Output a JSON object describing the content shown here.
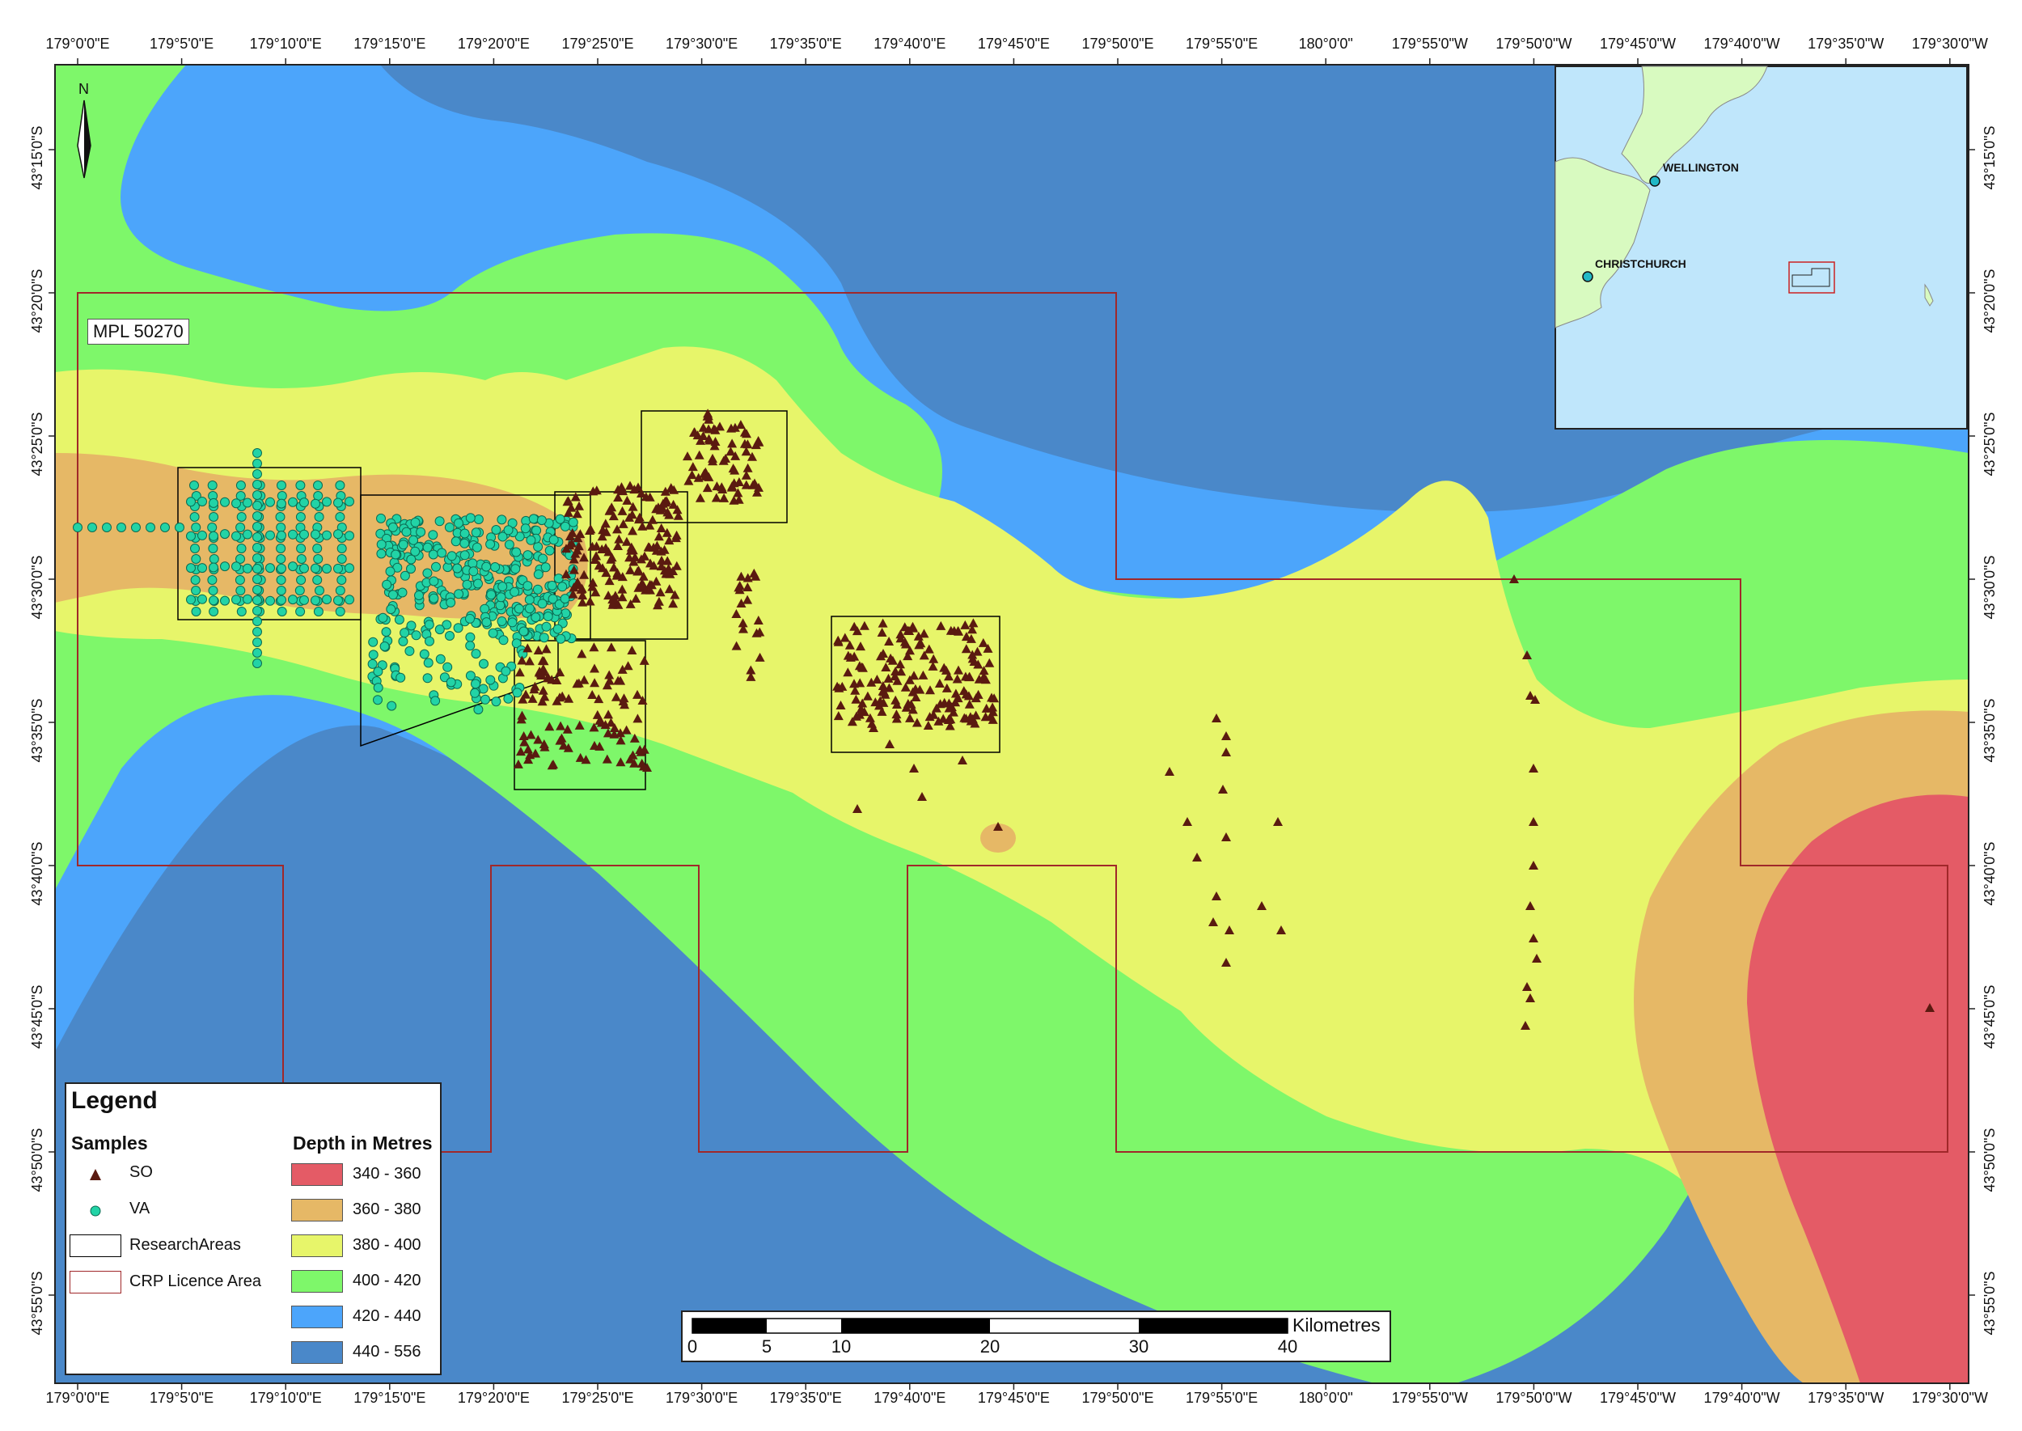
{
  "map": {
    "licence_label": "MPL 50270",
    "north": "N",
    "top_ticks": [
      "179°0'0\"E",
      "179°5'0\"E",
      "179°10'0\"E",
      "179°15'0\"E",
      "179°20'0\"E",
      "179°25'0\"E",
      "179°30'0\"E",
      "179°35'0\"E",
      "179°40'0\"E",
      "179°45'0\"E",
      "179°50'0\"E",
      "179°55'0\"E",
      "180°0'0\"",
      "179°55'0\"W",
      "179°50'0\"W",
      "179°45'0\"W",
      "179°40'0\"W",
      "179°35'0\"W",
      "179°30'0\"W"
    ],
    "side_ticks": [
      "43°15'0\"S",
      "43°20'0\"S",
      "43°25'0\"S",
      "43°30'0\"S",
      "43°35'0\"S",
      "43°40'0\"S",
      "43°45'0\"S",
      "43°50'0\"S",
      "43°55'0\"S"
    ]
  },
  "inset": {
    "wellington": "WELLINGTON",
    "christchurch": "CHRISTCHURCH"
  },
  "legend": {
    "title": "Legend",
    "samples_heading": "Samples",
    "depth_heading": "Depth in Metres",
    "samples": [
      {
        "label": "SO",
        "symbol": "triangle",
        "color": "#5a1a10"
      },
      {
        "label": "VA",
        "symbol": "circle",
        "color": "#22d3a6"
      },
      {
        "label": "ResearchAreas",
        "symbol": "box",
        "color": "#000000"
      },
      {
        "label": "CRP Licence Area",
        "symbol": "box",
        "color": "#a0282a"
      }
    ],
    "depths": [
      {
        "label": "340 - 360",
        "color": "#e45b66"
      },
      {
        "label": "360 - 380",
        "color": "#e6b866"
      },
      {
        "label": "380 - 400",
        "color": "#e7f56a"
      },
      {
        "label": "400 - 420",
        "color": "#7ef76a"
      },
      {
        "label": "420 - 440",
        "color": "#4ca5fb"
      },
      {
        "label": "440 - 556",
        "color": "#4a88c9"
      }
    ]
  },
  "scale": {
    "unit": "Kilometres",
    "labels": [
      "0",
      "5",
      "10",
      "20",
      "30",
      "40"
    ]
  },
  "colors": {
    "deep": "#4a88c9",
    "blue": "#4ca5fb",
    "green": "#7ef76a",
    "yellow": "#e7f56a",
    "orange": "#e6b866",
    "red": "#e45b66",
    "sea_inset": "#bfe6fb",
    "land_inset": "#d8fac0",
    "licence": "#a0282a",
    "so": "#5a1a10",
    "va": "#22d3a6"
  }
}
